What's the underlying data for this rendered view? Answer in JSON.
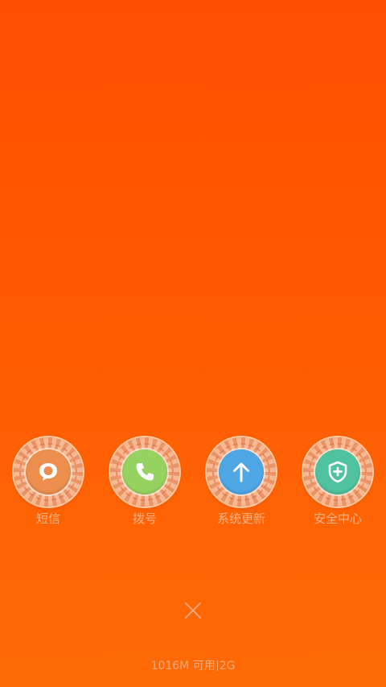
{
  "apps": [
    {
      "id": "sms",
      "label": "短信",
      "icon": "message-bubble-icon",
      "color": "#ec8e4d"
    },
    {
      "id": "dialer",
      "label": "拨号",
      "icon": "phone-icon",
      "color": "#96d260"
    },
    {
      "id": "update",
      "label": "系统更新",
      "icon": "arrow-up-icon",
      "color": "#4ea6e4"
    },
    {
      "id": "security",
      "label": "安全中心",
      "icon": "shield-plus-icon",
      "color": "#4fc29f"
    }
  ],
  "close": {
    "icon": "close-icon"
  },
  "memory": {
    "available": "1016M 可用",
    "total": "2G"
  }
}
